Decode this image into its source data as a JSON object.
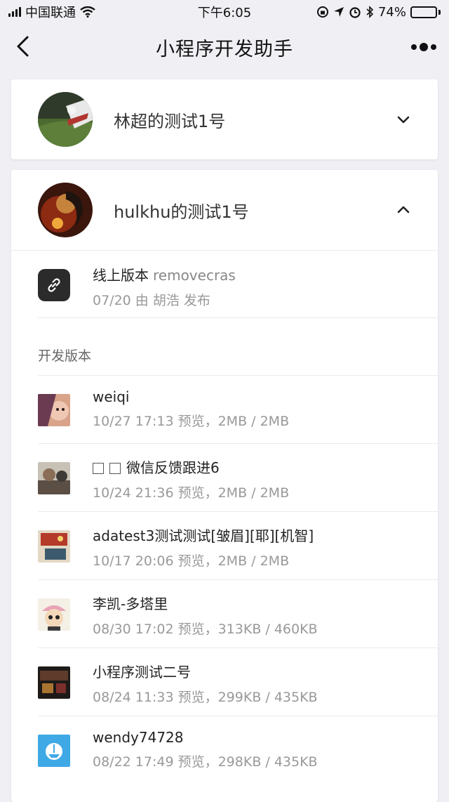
{
  "status_bar": {
    "carrier": "中国联通",
    "time": "下午6:05",
    "battery": "74%",
    "battery_level": 0.74
  },
  "nav": {
    "title": "小程序开发助手",
    "back_icon": "chevron-left-icon",
    "more_icon": "more-dots-icon"
  },
  "accounts": [
    {
      "name": "林超的测试1号",
      "expanded": false
    },
    {
      "name": "hulkhu的测试1号",
      "expanded": true
    }
  ],
  "online_version": {
    "label": "线上版本",
    "version": "removecras",
    "meta": "07/20 由 胡浩 发布"
  },
  "dev_section_label": "开发版本",
  "dev_versions": [
    {
      "title": "weiqi",
      "meta": "10/27 17:13 预览，2MB / 2MB",
      "has_boxes": false
    },
    {
      "title": "微信反馈跟进6",
      "meta": "10/24 21:36 预览，2MB / 2MB",
      "has_boxes": true
    },
    {
      "title": "adatest3测试测试[皱眉][耶][机智]",
      "meta": "10/17 20:06 预览，2MB / 2MB",
      "has_boxes": false
    },
    {
      "title": "李凯-多塔里",
      "meta": "08/30 17:02 预览，313KB / 460KB",
      "has_boxes": false
    },
    {
      "title": "小程序测试二号",
      "meta": "08/24 11:33 预览，299KB / 435KB",
      "has_boxes": false
    },
    {
      "title": "wendy74728",
      "meta": "08/22 17:49 预览，298KB / 435KB",
      "has_boxes": false
    }
  ]
}
